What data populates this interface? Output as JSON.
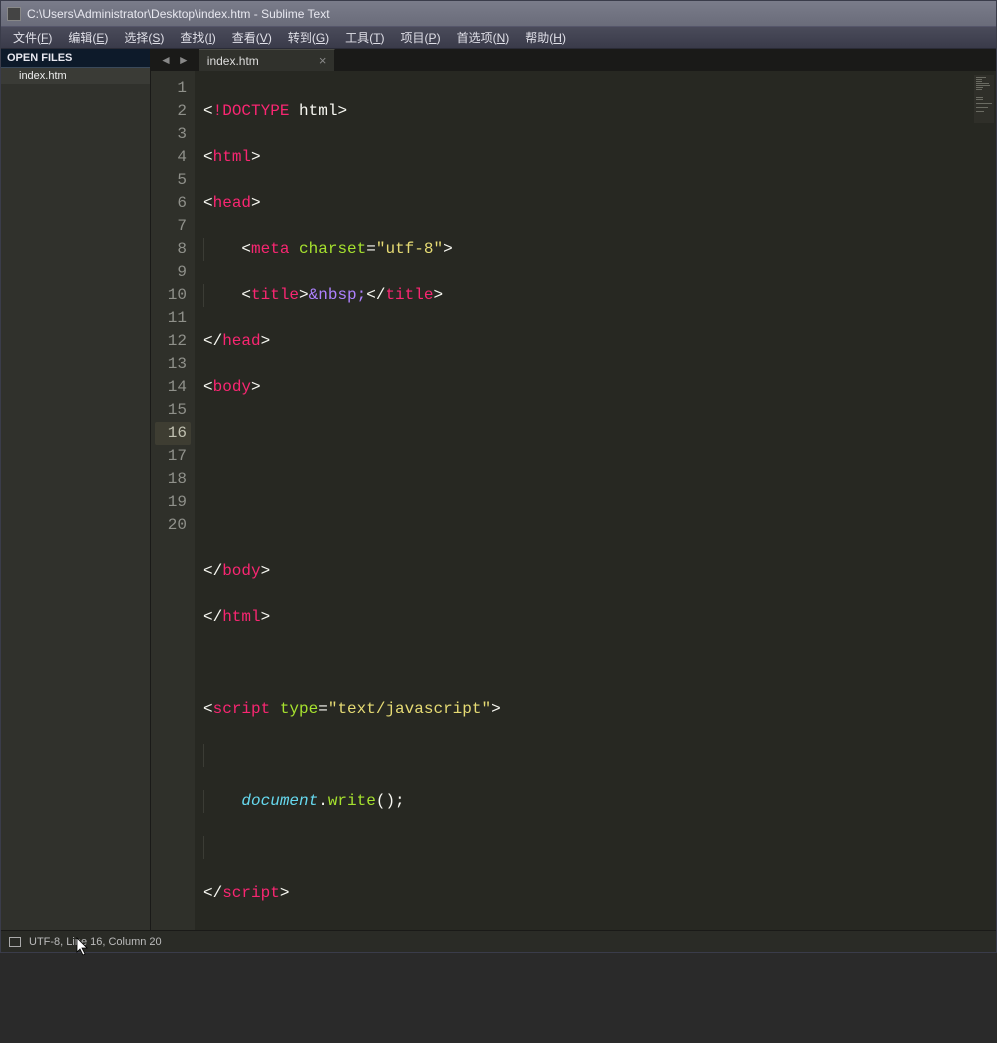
{
  "window": {
    "title": "C:\\Users\\Administrator\\Desktop\\index.htm - Sublime Text"
  },
  "menu": {
    "items": [
      {
        "label": "文件",
        "accel": "F"
      },
      {
        "label": "编辑",
        "accel": "E"
      },
      {
        "label": "选择",
        "accel": "S"
      },
      {
        "label": "查找",
        "accel": "I"
      },
      {
        "label": "查看",
        "accel": "V"
      },
      {
        "label": "转到",
        "accel": "G"
      },
      {
        "label": "工具",
        "accel": "T"
      },
      {
        "label": "项目",
        "accel": "P"
      },
      {
        "label": "首选项",
        "accel": "N"
      },
      {
        "label": "帮助",
        "accel": "H"
      }
    ]
  },
  "sidebar": {
    "header": "OPEN FILES",
    "files": [
      "index.htm"
    ]
  },
  "tabs": {
    "nav_back": "◄",
    "nav_fwd": "►",
    "active": {
      "label": "index.htm",
      "close": "×"
    }
  },
  "editor": {
    "line_numbers": [
      "1",
      "2",
      "3",
      "4",
      "5",
      "6",
      "7",
      "8",
      "9",
      "10",
      "11",
      "12",
      "13",
      "14",
      "15",
      "16",
      "17",
      "18",
      "19",
      "20"
    ],
    "current_line": 16,
    "tokens": {
      "doctype_bang": "!",
      "doctype_word": "DOCTYPE",
      "doctype_html": "html",
      "tag_html": "html",
      "tag_head": "head",
      "tag_meta": "meta",
      "attr_charset": "charset",
      "val_utf8": "\"utf-8\"",
      "tag_title": "title",
      "entity_nbsp": "&nbsp;",
      "tag_body": "body",
      "tag_script": "script",
      "attr_type": "type",
      "val_js": "\"text/javascript\"",
      "obj_document": "document",
      "fn_write": "write",
      "parens": "()",
      "semi": ";",
      "lt": "<",
      "gt": ">",
      "lt_slash": "</",
      "eq": "=",
      "dot": "."
    }
  },
  "status": {
    "text": "UTF-8, Line 16, Column 20"
  }
}
